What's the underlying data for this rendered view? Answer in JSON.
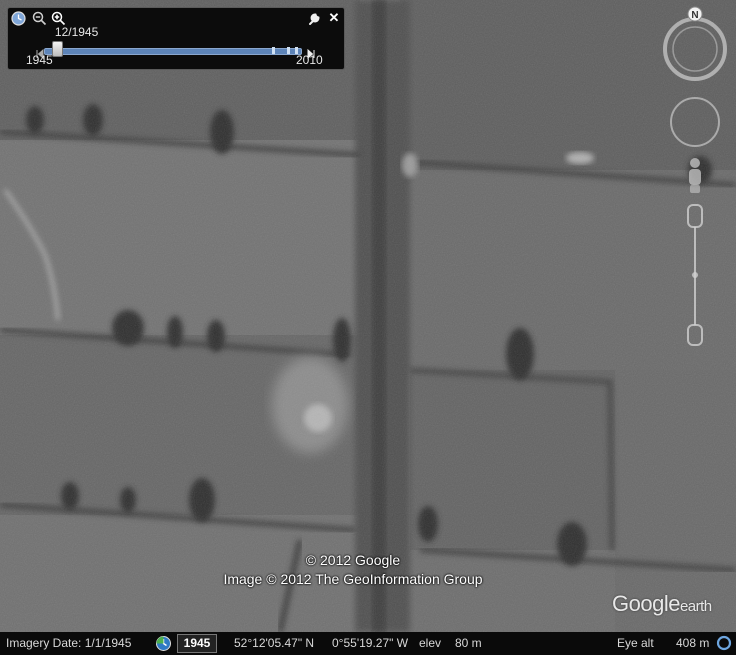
{
  "slider": {
    "current_date": "12/1945",
    "start_year": "1945",
    "end_year": "2010",
    "position_fraction": 0.05
  },
  "toolbar": {
    "history_icon": "clock-icon",
    "zoom_out_icon": "zoom-out-icon",
    "zoom_in_icon": "zoom-in-icon",
    "settings_icon": "wrench-icon",
    "close_label": "✕"
  },
  "navigation": {
    "north_label": "N"
  },
  "attribution": {
    "line1": "© 2012 Google",
    "line2": "Image © 2012 The GeoInformation Group"
  },
  "logo": {
    "google": "Google",
    "earth": "earth"
  },
  "status_bar": {
    "imagery_date": "Imagery Date: 1/1/1945",
    "year": "1945",
    "latitude": "52°12'05.47\" N",
    "longitude": "0°55'19.27\" W",
    "elev_label": "elev",
    "elev_value": "80 m",
    "eye_alt_label": "Eye alt",
    "eye_alt_value": "408 m"
  }
}
